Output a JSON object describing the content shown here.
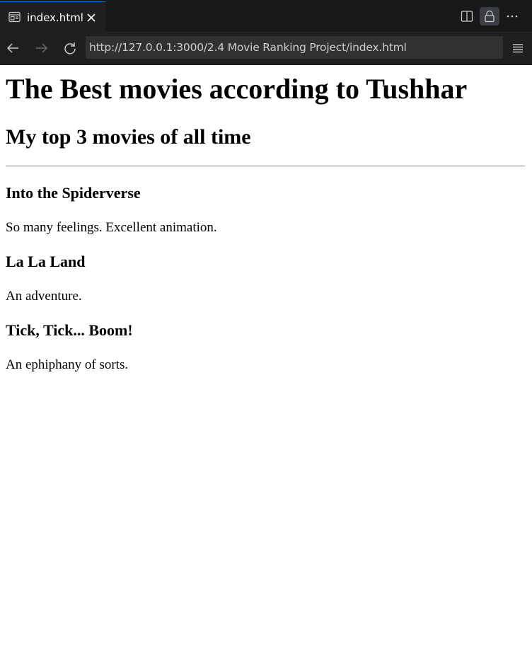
{
  "browser": {
    "tab": {
      "title": "index.html",
      "icon": "preview-icon"
    },
    "toolbar_icons": [
      "split-editor-icon",
      "lock-icon",
      "more-actions-icon"
    ],
    "nav_icons": [
      "back-arrow-icon",
      "forward-arrow-icon",
      "reload-icon",
      "menu-icon"
    ],
    "url": "http://127.0.0.1:3000/2.4 Movie Ranking Project/index.html",
    "colors": {
      "tab_accent": "#0078d4",
      "chrome_background": "#1f1f1f",
      "url_background": "#313131"
    }
  },
  "page": {
    "heading": "The Best movies according to Tushhar",
    "subheading": "My top 3 movies of all time",
    "movies": [
      {
        "title": "Into the Spiderverse",
        "description": "So many feelings. Excellent animation."
      },
      {
        "title": "La La Land",
        "description": "An adventure."
      },
      {
        "title": "Tick, Tick... Boom!",
        "description": "An ephiphany of sorts."
      }
    ]
  }
}
